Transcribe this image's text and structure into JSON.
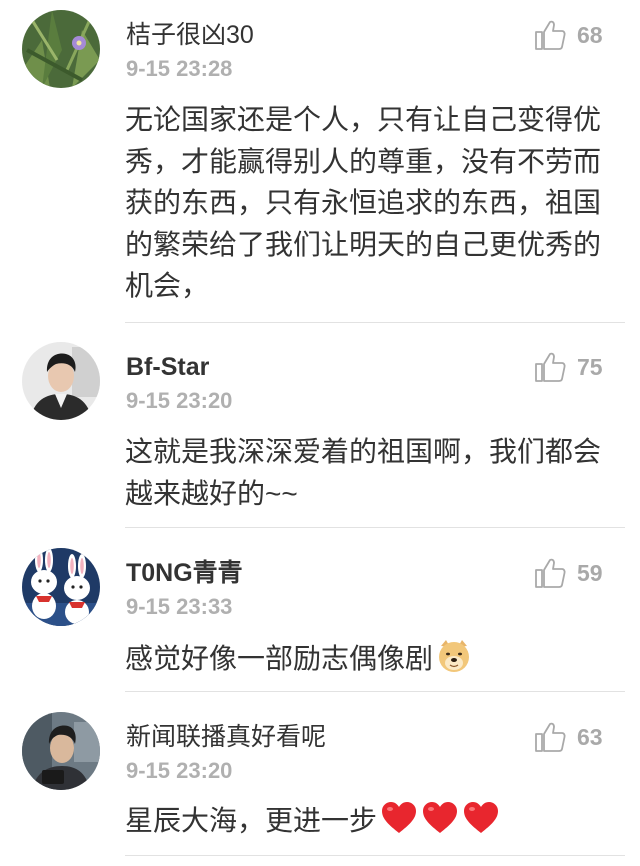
{
  "comments": [
    {
      "username": "桔子很凶30",
      "timestamp": "9-15 23:28",
      "likes": "68",
      "text": "无论国家还是个人，只有让自己变得优秀，才能赢得别人的尊重，没有不劳而获的东西，只有永恒追求的东西，祖国的繁荣给了我们让明天的自己更优秀的机会，"
    },
    {
      "username": "Bf-Star",
      "timestamp": "9-15 23:20",
      "likes": "75",
      "text": "这就是我深深爱着的祖国啊，我们都会越来越好的~~"
    },
    {
      "username": "T0NG青青",
      "timestamp": "9-15 23:33",
      "likes": "59",
      "text": "感觉好像一部励志偶像剧",
      "emoji": "doge-emoji"
    },
    {
      "username": "新闻联播真好看呢",
      "timestamp": "9-15 23:20",
      "likes": "63",
      "text": "星辰大海，更进一步",
      "emoji": "heart-emoji x3"
    }
  ],
  "icons": {
    "like": "thumbs-up-icon",
    "heart": "red-heart-emoji",
    "doge": "doge-emoji"
  },
  "colors": {
    "text": "#333333",
    "meta": "#b0b0b0",
    "divider": "#e2e2e2",
    "heart": "#e8262e"
  }
}
